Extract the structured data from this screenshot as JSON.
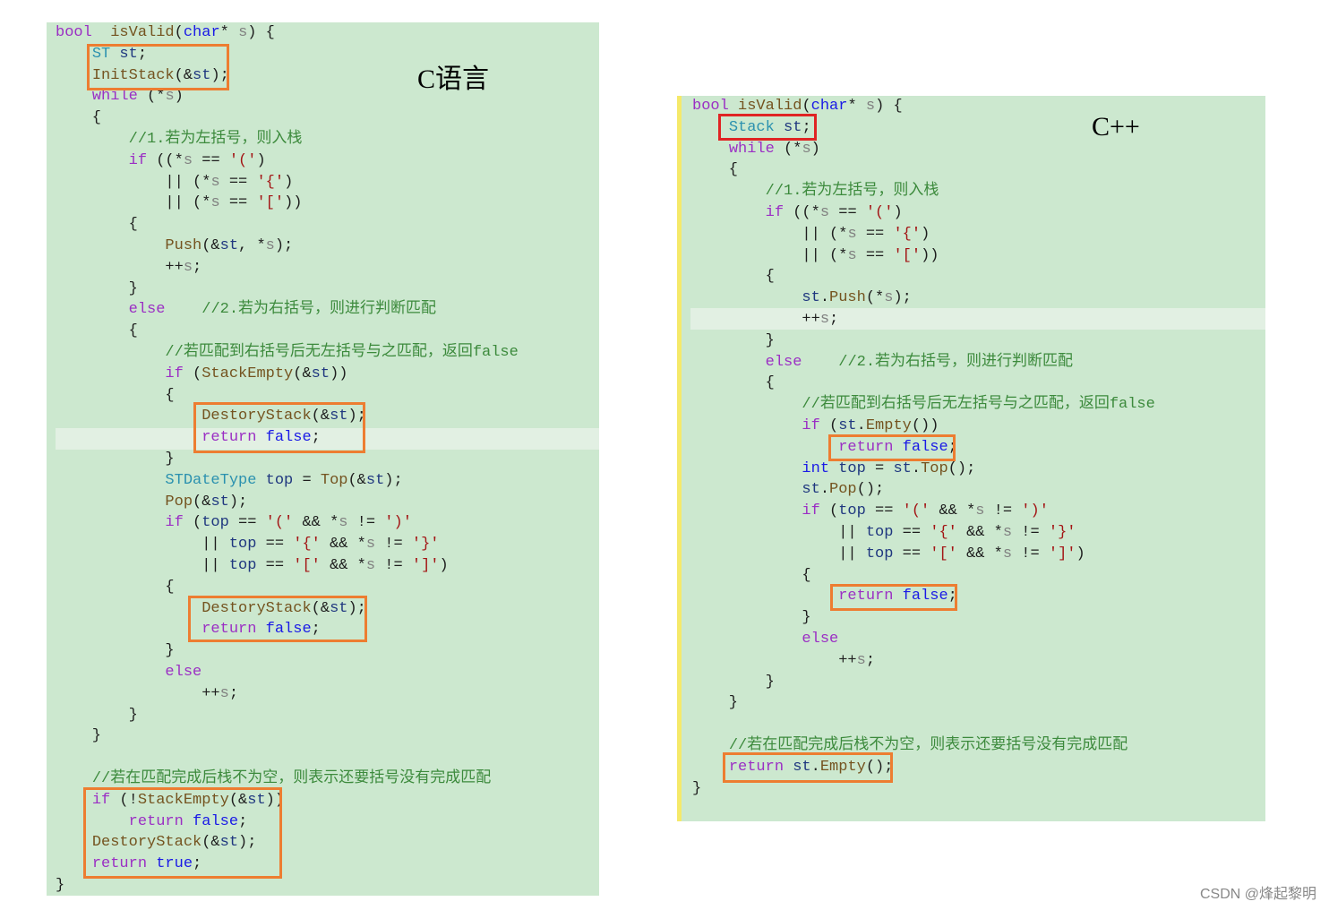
{
  "left_panel": {
    "label": "C语言",
    "lines": [
      [
        [
          "kw",
          "bool"
        ],
        [
          "",
          "  "
        ],
        [
          "fn",
          "isValid"
        ],
        [
          "",
          "("
        ],
        [
          "bl",
          "char"
        ],
        [
          "",
          "* "
        ],
        [
          "pr",
          "s"
        ],
        [
          "",
          ") {"
        ]
      ],
      [
        [
          "",
          "    "
        ],
        [
          "ty",
          "ST"
        ],
        [
          "",
          " "
        ],
        [
          "vr",
          "st"
        ],
        [
          "",
          ";"
        ]
      ],
      [
        [
          "",
          "    "
        ],
        [
          "fn",
          "InitStack"
        ],
        [
          "",
          "(&"
        ],
        [
          "vr",
          "st"
        ],
        [
          "",
          ");"
        ]
      ],
      [
        [
          "",
          "    "
        ],
        [
          "kw",
          "while"
        ],
        [
          "",
          " (*"
        ],
        [
          "pr",
          "s"
        ],
        [
          "",
          ")"
        ]
      ],
      [
        [
          "",
          "    {"
        ]
      ],
      [
        [
          "",
          "        "
        ],
        [
          "cm",
          "//1.若为左括号，则入栈"
        ]
      ],
      [
        [
          "",
          "        "
        ],
        [
          "kw",
          "if"
        ],
        [
          "",
          " ((*"
        ],
        [
          "pr",
          "s"
        ],
        [
          "",
          " == "
        ],
        [
          "st",
          "'('"
        ],
        [
          "",
          ")"
        ]
      ],
      [
        [
          "",
          "            || (*"
        ],
        [
          "pr",
          "s"
        ],
        [
          "",
          " == "
        ],
        [
          "st",
          "'{'"
        ],
        [
          "",
          ")"
        ]
      ],
      [
        [
          "",
          "            || (*"
        ],
        [
          "pr",
          "s"
        ],
        [
          "",
          " == "
        ],
        [
          "st",
          "'['"
        ],
        [
          "",
          "))"
        ]
      ],
      [
        [
          "",
          "        {"
        ]
      ],
      [
        [
          "",
          "            "
        ],
        [
          "fn",
          "Push"
        ],
        [
          "",
          "(&"
        ],
        [
          "vr",
          "st"
        ],
        [
          "",
          ", *"
        ],
        [
          "pr",
          "s"
        ],
        [
          "",
          ");"
        ]
      ],
      [
        [
          "",
          "            ++"
        ],
        [
          "pr",
          "s"
        ],
        [
          "",
          ";"
        ]
      ],
      [
        [
          "",
          "        }"
        ]
      ],
      [
        [
          "",
          "        "
        ],
        [
          "kw",
          "else"
        ],
        [
          "",
          "    "
        ],
        [
          "cm",
          "//2.若为右括号，则进行判断匹配"
        ]
      ],
      [
        [
          "",
          "        {"
        ]
      ],
      [
        [
          "",
          "            "
        ],
        [
          "cm",
          "//若匹配到右括号后无左括号与之匹配，返回false"
        ]
      ],
      [
        [
          "",
          "            "
        ],
        [
          "kw",
          "if"
        ],
        [
          "",
          " ("
        ],
        [
          "fn",
          "StackEmpty"
        ],
        [
          "",
          "(&"
        ],
        [
          "vr",
          "st"
        ],
        [
          "",
          "))"
        ]
      ],
      [
        [
          "",
          "            {"
        ]
      ],
      [
        [
          "",
          "                "
        ],
        [
          "fn",
          "DestoryStack"
        ],
        [
          "",
          "(&"
        ],
        [
          "vr",
          "st"
        ],
        [
          "",
          ");"
        ]
      ],
      [
        [
          "",
          "                "
        ],
        [
          "kw",
          "return"
        ],
        [
          "",
          " "
        ],
        [
          "bl",
          "false"
        ],
        [
          "",
          ";"
        ]
      ],
      [
        [
          "",
          "            }"
        ]
      ],
      [
        [
          "",
          "            "
        ],
        [
          "ty",
          "STDateType"
        ],
        [
          "",
          " "
        ],
        [
          "vr",
          "top"
        ],
        [
          "",
          " = "
        ],
        [
          "fn",
          "Top"
        ],
        [
          "",
          "(&"
        ],
        [
          "vr",
          "st"
        ],
        [
          "",
          ");"
        ]
      ],
      [
        [
          "",
          "            "
        ],
        [
          "fn",
          "Pop"
        ],
        [
          "",
          "(&"
        ],
        [
          "vr",
          "st"
        ],
        [
          "",
          ");"
        ]
      ],
      [
        [
          "",
          "            "
        ],
        [
          "kw",
          "if"
        ],
        [
          "",
          " ("
        ],
        [
          "vr",
          "top"
        ],
        [
          "",
          " == "
        ],
        [
          "st",
          "'('"
        ],
        [
          "",
          " && *"
        ],
        [
          "pr",
          "s"
        ],
        [
          "",
          " != "
        ],
        [
          "st",
          "')'"
        ]
      ],
      [
        [
          "",
          "                || "
        ],
        [
          "vr",
          "top"
        ],
        [
          "",
          " == "
        ],
        [
          "st",
          "'{'"
        ],
        [
          "",
          " && *"
        ],
        [
          "pr",
          "s"
        ],
        [
          "",
          " != "
        ],
        [
          "st",
          "'}'"
        ]
      ],
      [
        [
          "",
          "                || "
        ],
        [
          "vr",
          "top"
        ],
        [
          "",
          " == "
        ],
        [
          "st",
          "'['"
        ],
        [
          "",
          " && *"
        ],
        [
          "pr",
          "s"
        ],
        [
          "",
          " != "
        ],
        [
          "st",
          "']'"
        ],
        [
          "",
          ")"
        ]
      ],
      [
        [
          "",
          "            {"
        ]
      ],
      [
        [
          "",
          "                "
        ],
        [
          "fn",
          "DestoryStack"
        ],
        [
          "",
          "(&"
        ],
        [
          "vr",
          "st"
        ],
        [
          "",
          ");"
        ]
      ],
      [
        [
          "",
          "                "
        ],
        [
          "kw",
          "return"
        ],
        [
          "",
          " "
        ],
        [
          "bl",
          "false"
        ],
        [
          "",
          ";"
        ]
      ],
      [
        [
          "",
          "            }"
        ]
      ],
      [
        [
          "",
          "            "
        ],
        [
          "kw",
          "else"
        ]
      ],
      [
        [
          "",
          "                ++"
        ],
        [
          "pr",
          "s"
        ],
        [
          "",
          ";"
        ]
      ],
      [
        [
          "",
          "        }"
        ]
      ],
      [
        [
          "",
          "    }"
        ]
      ],
      [
        [
          "",
          ""
        ]
      ],
      [
        [
          "",
          "    "
        ],
        [
          "cm",
          "//若在匹配完成后栈不为空，则表示还要括号没有完成匹配"
        ]
      ],
      [
        [
          "",
          "    "
        ],
        [
          "kw",
          "if"
        ],
        [
          "",
          " (!"
        ],
        [
          "fn",
          "StackEmpty"
        ],
        [
          "",
          "(&"
        ],
        [
          "vr",
          "st"
        ],
        [
          "",
          "))"
        ]
      ],
      [
        [
          "",
          "        "
        ],
        [
          "kw",
          "return"
        ],
        [
          "",
          " "
        ],
        [
          "bl",
          "false"
        ],
        [
          "",
          ";"
        ]
      ],
      [
        [
          "",
          "    "
        ],
        [
          "fn",
          "DestoryStack"
        ],
        [
          "",
          "(&"
        ],
        [
          "vr",
          "st"
        ],
        [
          "",
          ");"
        ]
      ],
      [
        [
          "",
          "    "
        ],
        [
          "kw",
          "return"
        ],
        [
          "",
          " "
        ],
        [
          "bl",
          "true"
        ],
        [
          "",
          ";"
        ]
      ],
      [
        [
          "",
          "}"
        ]
      ]
    ]
  },
  "right_panel": {
    "label": "C++",
    "lines": [
      [
        [
          "kw",
          "bool"
        ],
        [
          "",
          " "
        ],
        [
          "fn",
          "isValid"
        ],
        [
          "",
          "("
        ],
        [
          "bl",
          "char"
        ],
        [
          "",
          "* "
        ],
        [
          "pr",
          "s"
        ],
        [
          "",
          ") {"
        ]
      ],
      [
        [
          "",
          "    "
        ],
        [
          "ty",
          "Stack"
        ],
        [
          "",
          " "
        ],
        [
          "vr",
          "st"
        ],
        [
          "",
          ";"
        ]
      ],
      [
        [
          "",
          "    "
        ],
        [
          "kw",
          "while"
        ],
        [
          "",
          " (*"
        ],
        [
          "pr",
          "s"
        ],
        [
          "",
          ")"
        ]
      ],
      [
        [
          "",
          "    {"
        ]
      ],
      [
        [
          "",
          "        "
        ],
        [
          "cm",
          "//1.若为左括号，则入栈"
        ]
      ],
      [
        [
          "",
          "        "
        ],
        [
          "kw",
          "if"
        ],
        [
          "",
          " ((*"
        ],
        [
          "pr",
          "s"
        ],
        [
          "",
          " == "
        ],
        [
          "st",
          "'('"
        ],
        [
          "",
          ")"
        ]
      ],
      [
        [
          "",
          "            || (*"
        ],
        [
          "pr",
          "s"
        ],
        [
          "",
          " == "
        ],
        [
          "st",
          "'{'"
        ],
        [
          "",
          ")"
        ]
      ],
      [
        [
          "",
          "            || (*"
        ],
        [
          "pr",
          "s"
        ],
        [
          "",
          " == "
        ],
        [
          "st",
          "'['"
        ],
        [
          "",
          "))"
        ]
      ],
      [
        [
          "",
          "        {"
        ]
      ],
      [
        [
          "",
          "            "
        ],
        [
          "vr",
          "st"
        ],
        [
          "",
          "."
        ],
        [
          "fn",
          "Push"
        ],
        [
          "",
          "(*"
        ],
        [
          "pr",
          "s"
        ],
        [
          "",
          ");"
        ]
      ],
      [
        [
          "",
          "            ++"
        ],
        [
          "pr",
          "s"
        ],
        [
          "",
          ";"
        ]
      ],
      [
        [
          "",
          "        }"
        ]
      ],
      [
        [
          "",
          "        "
        ],
        [
          "kw",
          "else"
        ],
        [
          "",
          "    "
        ],
        [
          "cm",
          "//2.若为右括号，则进行判断匹配"
        ]
      ],
      [
        [
          "",
          "        {"
        ]
      ],
      [
        [
          "",
          "            "
        ],
        [
          "cm",
          "//若匹配到右括号后无左括号与之匹配，返回false"
        ]
      ],
      [
        [
          "",
          "            "
        ],
        [
          "kw",
          "if"
        ],
        [
          "",
          " ("
        ],
        [
          "vr",
          "st"
        ],
        [
          "",
          "."
        ],
        [
          "fn",
          "Empty"
        ],
        [
          "",
          "())"
        ]
      ],
      [
        [
          "",
          "                "
        ],
        [
          "kw",
          "return"
        ],
        [
          "",
          " "
        ],
        [
          "bl",
          "false"
        ],
        [
          "",
          ";"
        ]
      ],
      [
        [
          "",
          "            "
        ],
        [
          "bl",
          "int"
        ],
        [
          "",
          " "
        ],
        [
          "vr",
          "top"
        ],
        [
          "",
          " = "
        ],
        [
          "vr",
          "st"
        ],
        [
          "",
          "."
        ],
        [
          "fn",
          "Top"
        ],
        [
          "",
          "();"
        ]
      ],
      [
        [
          "",
          "            "
        ],
        [
          "vr",
          "st"
        ],
        [
          "",
          "."
        ],
        [
          "fn",
          "Pop"
        ],
        [
          "",
          "();"
        ]
      ],
      [
        [
          "",
          "            "
        ],
        [
          "kw",
          "if"
        ],
        [
          "",
          " ("
        ],
        [
          "vr",
          "top"
        ],
        [
          "",
          " == "
        ],
        [
          "st",
          "'('"
        ],
        [
          "",
          " && *"
        ],
        [
          "pr",
          "s"
        ],
        [
          "",
          " != "
        ],
        [
          "st",
          "')'"
        ]
      ],
      [
        [
          "",
          "                || "
        ],
        [
          "vr",
          "top"
        ],
        [
          "",
          " == "
        ],
        [
          "st",
          "'{'"
        ],
        [
          "",
          " && *"
        ],
        [
          "pr",
          "s"
        ],
        [
          "",
          " != "
        ],
        [
          "st",
          "'}'"
        ]
      ],
      [
        [
          "",
          "                || "
        ],
        [
          "vr",
          "top"
        ],
        [
          "",
          " == "
        ],
        [
          "st",
          "'['"
        ],
        [
          "",
          " && *"
        ],
        [
          "pr",
          "s"
        ],
        [
          "",
          " != "
        ],
        [
          "st",
          "']'"
        ],
        [
          "",
          ")"
        ]
      ],
      [
        [
          "",
          "            {"
        ]
      ],
      [
        [
          "",
          "                "
        ],
        [
          "kw",
          "return"
        ],
        [
          "",
          " "
        ],
        [
          "bl",
          "false"
        ],
        [
          "",
          ";"
        ]
      ],
      [
        [
          "",
          "            }"
        ]
      ],
      [
        [
          "",
          "            "
        ],
        [
          "kw",
          "else"
        ]
      ],
      [
        [
          "",
          "                ++"
        ],
        [
          "pr",
          "s"
        ],
        [
          "",
          ";"
        ]
      ],
      [
        [
          "",
          "        }"
        ]
      ],
      [
        [
          "",
          "    }"
        ]
      ],
      [
        [
          "",
          ""
        ]
      ],
      [
        [
          "",
          "    "
        ],
        [
          "cm",
          "//若在匹配完成后栈不为空，则表示还要括号没有完成匹配"
        ]
      ],
      [
        [
          "",
          "    "
        ],
        [
          "kw",
          "return"
        ],
        [
          "",
          " "
        ],
        [
          "vr",
          "st"
        ],
        [
          "",
          "."
        ],
        [
          "fn",
          "Empty"
        ],
        [
          "",
          "();"
        ]
      ],
      [
        [
          "",
          "}"
        ]
      ]
    ]
  },
  "watermark": "CSDN @烽起黎明"
}
